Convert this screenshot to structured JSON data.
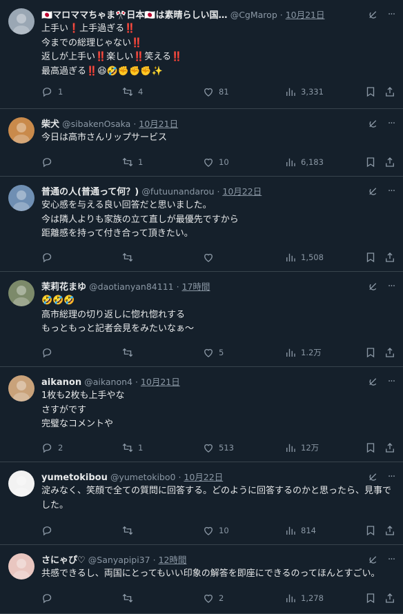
{
  "tweets": [
    {
      "name": "🇯🇵マロママちゃま🎌日本🇯🇵は素晴らしい国…",
      "handle": "@CgMarop",
      "time": "10月21日",
      "lines": [
        "上手い❗上手過ぎる‼️",
        "今までの総理じゃない‼️",
        "返しが上手い‼️楽しい‼️笑える‼️",
        "最高過ぎる‼️😆🤣✊✊✊✨"
      ],
      "reply": "1",
      "retweet": "4",
      "like": "81",
      "views": "3,331",
      "avatar_color": "#9aa7b4"
    },
    {
      "name": "柴犬",
      "handle": "@sibakenOsaka",
      "time": "10月21日",
      "lines": [
        "今日は高市さんリップサービス"
      ],
      "reply": "",
      "retweet": "1",
      "like": "10",
      "views": "6,183",
      "avatar_color": "#c98a4b"
    },
    {
      "name": "普通の人(普通って何？)",
      "handle": "@futuunandarou",
      "time": "10月22日",
      "lines": [
        "安心感を与える良い回答だと思いました。",
        "今は隣人よりも家族の立て直しが最優先ですから",
        "距離感を持って付き合って頂きたい。"
      ],
      "reply": "",
      "retweet": "",
      "like": "",
      "views": "1,508",
      "avatar_color": "#6f8fb3"
    },
    {
      "name": "茉莉花まゆ",
      "handle": "@daotianyan84111",
      "time": "17時間",
      "lines": [
        "🤣🤣🤣",
        "高市総理の切り返しに惚れ惚れする",
        "もっともっと記者会見をみたいなぁ〜"
      ],
      "reply": "",
      "retweet": "",
      "like": "5",
      "views": "1.2万",
      "avatar_color": "#7c8a6a"
    },
    {
      "name": "aikanon",
      "handle": "@aikanon4",
      "time": "10月21日",
      "lines": [
        "1枚も2枚も上手やな",
        "さすがです",
        "完璧なコメントや"
      ],
      "reply": "2",
      "retweet": "1",
      "like": "513",
      "views": "12万",
      "avatar_color": "#c9a27a"
    },
    {
      "name": "yumetokibou",
      "handle": "@yumetokibo0",
      "time": "10月22日",
      "lines": [
        "淀みなく、笑顔で全ての質問に回答する。どのように回答するのかと思ったら、見事でした。"
      ],
      "reply": "",
      "retweet": "",
      "like": "10",
      "views": "814",
      "avatar_color": "#f2f2f2"
    },
    {
      "name": "さにゃぴ♡",
      "handle": "@Sanyapipi37",
      "time": "12時間",
      "lines": [
        "共感できるし、両国にとってもいい印象の解答を即座にできるのってほんとすごい。"
      ],
      "reply": "",
      "retweet": "",
      "like": "2",
      "views": "1,278",
      "avatar_color": "#e9c6c0"
    }
  ]
}
